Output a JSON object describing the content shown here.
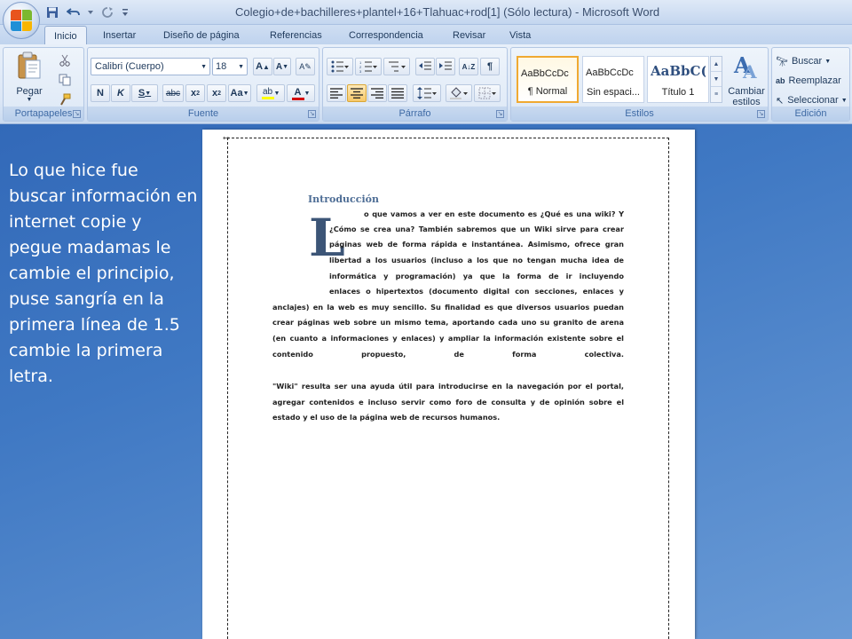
{
  "window": {
    "title": "Colegio+de+bachilleres+plantel+16+Tlahuac+rod[1] (Sólo lectura) - Microsoft Word"
  },
  "quick_access": {
    "save_icon": "save-icon",
    "undo_icon": "undo-icon",
    "redo_icon": "redo-icon",
    "customize_icon": "customize-qat-icon"
  },
  "tabs": [
    {
      "label": "Inicio",
      "active": true
    },
    {
      "label": "Insertar"
    },
    {
      "label": "Diseño de página"
    },
    {
      "label": "Referencias"
    },
    {
      "label": "Correspondencia"
    },
    {
      "label": "Revisar"
    },
    {
      "label": "Vista"
    }
  ],
  "ribbon": {
    "clipboard": {
      "label": "Portapapeles",
      "paste_label": "Pegar"
    },
    "font": {
      "label": "Fuente",
      "font_name": "Calibri (Cuerpo)",
      "font_size": "18"
    },
    "paragraph": {
      "label": "Párrafo"
    },
    "styles": {
      "label": "Estilos",
      "tiles": [
        {
          "sample": "AaBbCcDc",
          "name": "¶ Normal",
          "selected": true
        },
        {
          "sample": "AaBbCcDc",
          "name": "Sin espaci..."
        },
        {
          "sample": "AaBbC(",
          "name": "Título 1"
        }
      ],
      "change_styles_label": "Cambiar estilos"
    },
    "editing": {
      "label": "Edición",
      "find_label": "Buscar",
      "replace_label": "Reemplazar",
      "select_label": "Seleccionar"
    }
  },
  "caption": "Lo que hice fue buscar información en internet copie y pegue madamas le cambie el principio, puse sangría en la primera línea de 1.5 cambie la primera letra.",
  "document": {
    "heading": "Introducción",
    "drop_cap": "L",
    "lines": [
      "o que vamos a ver en este documento es ¿Qué es una wiki? Y",
      "¿Cómo se crea una? También sabremos que un Wiki sirve para crear",
      "páginas web de forma rápida e instantánea. Asimismo, ofrece gran",
      "libertad a los usuarios (incluso a los que no tengan mucha idea de",
      "informática y programación) ya que la forma de ir incluyendo",
      "enlaces o hipertextos (documento digital con secciones, enlaces y",
      "anclajes) en la web es muy sencillo. Su finalidad es que diversos usuarios puedan",
      "crear páginas web sobre un mismo tema, aportando cada uno su granito de arena",
      "(en cuanto a informaciones y enlaces) y ampliar la información existente sobre el",
      "contenido propuesto, de forma colectiva.",
      "\"Wiki\" resulta ser una ayuda útil para introducirse en la navegación por el portal,",
      "agregar contenidos e incluso servir como foro de consulta y de opinión sobre el",
      "estado y el uso de la página web de recursos humanos."
    ]
  }
}
